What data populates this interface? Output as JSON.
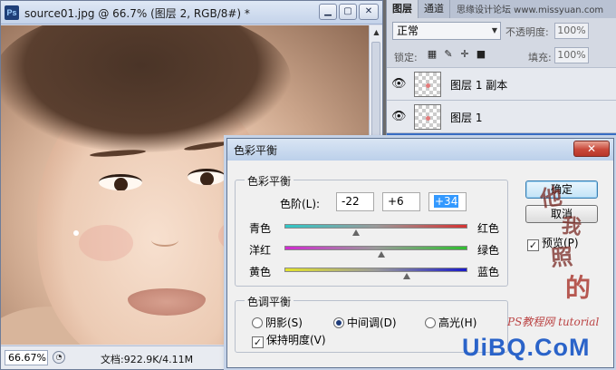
{
  "document": {
    "title": "source01.jpg @ 66.7% (图层 2, RGB/8#) *",
    "app_logo": "Ps",
    "window_buttons": {
      "minimize": "▁",
      "restore": "▢",
      "close": "✕"
    },
    "zoom": "66.67%",
    "doc_info": "文档:922.9K/4.11M"
  },
  "layers_panel": {
    "tabs": [
      "图层",
      "通道"
    ],
    "blend_mode": "正常",
    "opacity_label": "不透明度:",
    "opacity_value": "100%",
    "lock_label": "锁定:",
    "fill_label": "填充:",
    "fill_value": "100%",
    "layers": [
      {
        "name": "图层 1 副本"
      },
      {
        "name": "图层 1"
      }
    ]
  },
  "dialog": {
    "title": "色彩平衡",
    "close_label": "✕",
    "color_balance_group": "色彩平衡",
    "levels_label": "色阶(L):",
    "levels": [
      "-22",
      "+6",
      "+34"
    ],
    "sliders": [
      {
        "left": "青色",
        "right": "红色",
        "value": -22,
        "gradient": [
          "#2fc7c7",
          "#d63232"
        ]
      },
      {
        "left": "洋红",
        "right": "绿色",
        "value": 6,
        "gradient": [
          "#d12ad1",
          "#2fbf2f"
        ]
      },
      {
        "left": "黄色",
        "right": "蓝色",
        "value": 34,
        "gradient": [
          "#e3e32b",
          "#1a1ac9"
        ]
      }
    ],
    "tone_group": "色调平衡",
    "tones": [
      {
        "label": "阴影(S)",
        "selected": false
      },
      {
        "label": "中间调(D)",
        "selected": true
      },
      {
        "label": "高光(H)",
        "selected": false
      }
    ],
    "preserve_luminosity": "保持明度(V)",
    "preserve_checked": true,
    "ok_label": "确定",
    "cancel_label": "取消",
    "preview_label": "预览(P)",
    "preview_checked": true
  },
  "watermarks": {
    "top_text": "思缘设计论坛 www.missyuan.com",
    "stamp_chars": [
      "他",
      "我",
      "照",
      "的"
    ],
    "site_text": "PS教程网",
    "site_sub": "tutorial",
    "logo": "UiBQ.CoM"
  }
}
